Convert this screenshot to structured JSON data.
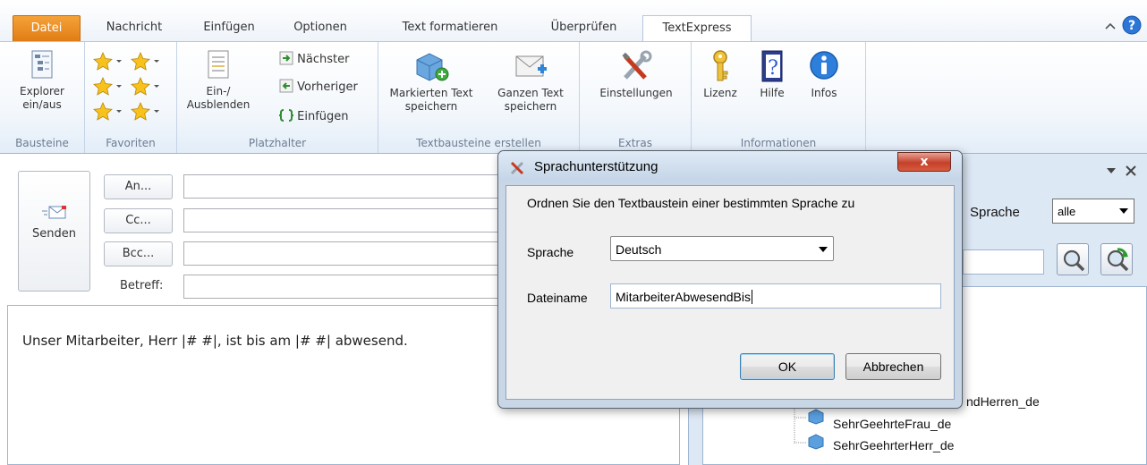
{
  "tabs": [
    "Datei",
    "Nachricht",
    "Einfügen",
    "Optionen",
    "Text formatieren",
    "Überprüfen",
    "TextExpress"
  ],
  "ribbon": {
    "bausteine": {
      "label": "Bausteine",
      "explorer": "Explorer ein/aus"
    },
    "favoriten": {
      "label": "Favoriten"
    },
    "platzhalter": {
      "label": "Platzhalter",
      "einausblenden": "Ein-/ Ausblenden",
      "naechster": "Nächster",
      "vorheriger": "Vorheriger",
      "einfuegen": "Einfügen"
    },
    "erstellen": {
      "label": "Textbausteine erstellen",
      "markierten": "Markierten Text speichern",
      "ganzen": "Ganzen Text speichern"
    },
    "extras": {
      "label": "Extras",
      "einstellungen": "Einstellungen"
    },
    "informationen": {
      "label": "Informationen",
      "lizenz": "Lizenz",
      "hilfe": "Hilfe",
      "infos": "Infos"
    }
  },
  "compose": {
    "send": "Senden",
    "to": "An...",
    "cc": "Cc...",
    "bcc": "Bcc...",
    "subject": "Betreff:",
    "body": "Unser Mitarbeiter, Herr |# #|, ist bis am |# #| abwesend."
  },
  "pane": {
    "language_label": "Sprache",
    "language_value": "alle",
    "tree": [
      "ndHerren_de",
      "SehrGeehrteFrau_de",
      "SehrGeehrterHerr_de"
    ]
  },
  "dialog": {
    "title": "Sprachunterstützung",
    "close": "x",
    "instruction": "Ordnen Sie den Textbaustein einer bestimmten Sprache zu",
    "language_label": "Sprache",
    "language_value": "Deutsch",
    "filename_label": "Dateiname",
    "filename_value": "MitarbeiterAbwesendBis",
    "ok": "OK",
    "cancel": "Abbrechen"
  },
  "colors": {
    "file_tab": "#e57f17",
    "dialog_close": "#c4412a",
    "ribbon_bg": "#f4f8fc"
  }
}
